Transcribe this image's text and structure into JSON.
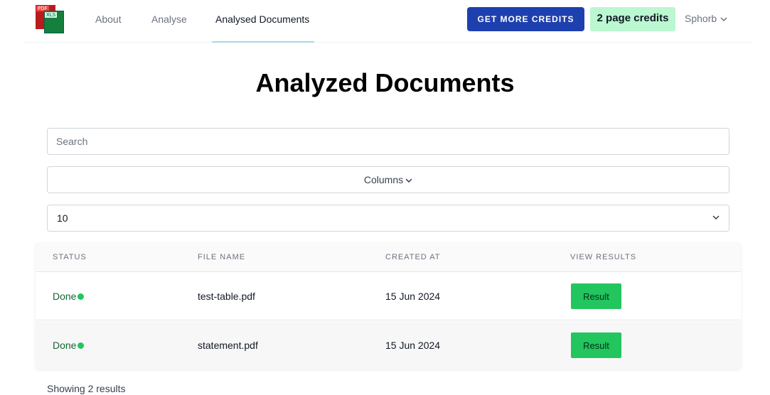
{
  "header": {
    "logo_tags": [
      "PDF",
      "XLS"
    ],
    "nav": [
      {
        "label": "About"
      },
      {
        "label": "Analyse"
      },
      {
        "label": "Analysed Documents",
        "active": true
      }
    ],
    "get_credits_label": "GET MORE CREDITS",
    "credits_badge": "2 page credits",
    "user_name": "Sphorb"
  },
  "main": {
    "title": "Analyzed Documents",
    "search_placeholder": "Search",
    "columns_label": "Columns",
    "page_size_value": "10",
    "table": {
      "headers": [
        "STATUS",
        "FILE NAME",
        "CREATED AT",
        "VIEW RESULTS"
      ],
      "rows": [
        {
          "status": "Done",
          "file_name": "test-table.pdf",
          "created_at": "15 Jun 2024",
          "action": "Result"
        },
        {
          "status": "Done",
          "file_name": "statement.pdf",
          "created_at": "15 Jun 2024",
          "action": "Result"
        }
      ]
    },
    "footer_text": "Showing 2 results"
  },
  "colors": {
    "primary": "#1e40af",
    "success": "#22c55e",
    "badge_bg": "#bbf7d0",
    "status_text": "#166534"
  },
  "icons": {
    "logo": "pdf-xls-logo-icon",
    "user_menu": "chevron-down-icon",
    "columns": "chevron-down-icon",
    "select": "chevron-down-icon",
    "status": "status-dot-icon"
  }
}
